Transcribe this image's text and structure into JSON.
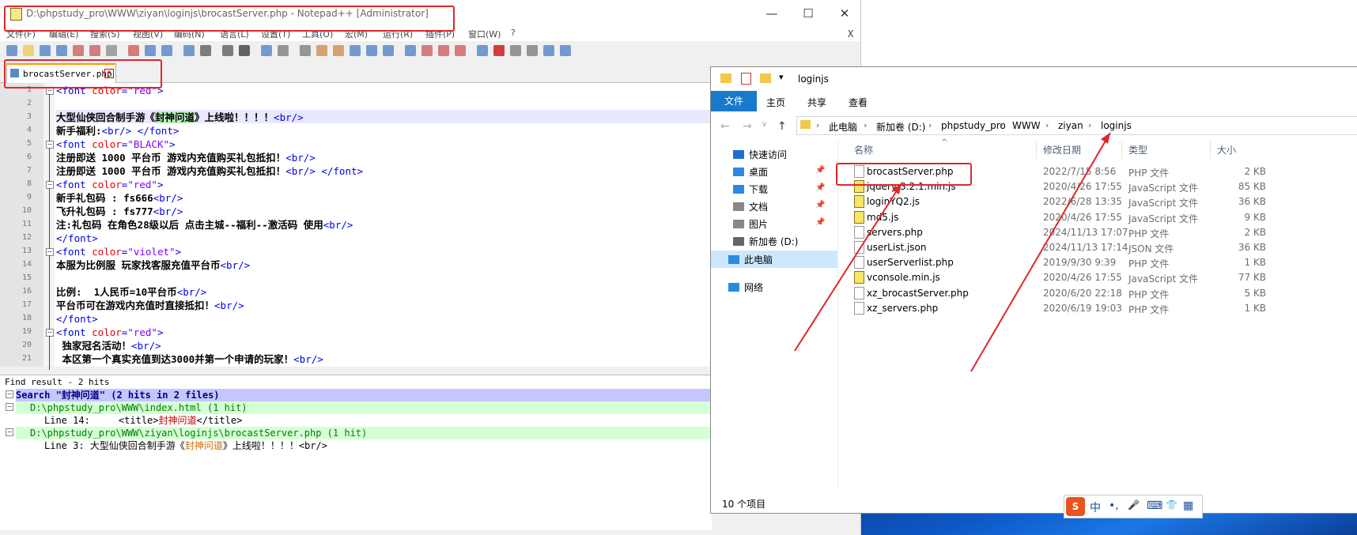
{
  "notepad": {
    "title": "D:\\phpstudy_pro\\WWW\\ziyan\\loginjs\\brocastServer.php - Notepad++ [Administrator]",
    "menu": [
      "文件(F)",
      "编辑(E)",
      "搜索(S)",
      "视图(V)",
      "编码(N)",
      "语言(L)",
      "设置(T)",
      "工具(O)",
      "宏(M)",
      "运行(R)",
      "插件(P)",
      "窗口(W)",
      "?"
    ],
    "close_x": "X",
    "tab_label": "brocastServer.php",
    "lines": [
      {
        "n": "1",
        "parts": [
          {
            "c": "tag",
            "t": "<font "
          },
          {
            "c": "attr",
            "t": "color"
          },
          {
            "c": "tag",
            "t": "="
          },
          {
            "c": "val",
            "t": "\"red\""
          },
          {
            "c": "tag",
            "t": ">"
          }
        ]
      },
      {
        "n": "2",
        "parts": []
      },
      {
        "n": "3",
        "parts": [
          {
            "c": "b",
            "t": "大型仙侠回合制手游《"
          },
          {
            "c": "b mark",
            "t": "封神问道"
          },
          {
            "c": "b",
            "t": "》上线啦！！！！"
          },
          {
            "c": "tag",
            "t": "<br/>"
          }
        ]
      },
      {
        "n": "4",
        "parts": [
          {
            "c": "b",
            "t": "新手福利:"
          },
          {
            "c": "tag",
            "t": "<br/> </font>"
          }
        ]
      },
      {
        "n": "5",
        "parts": [
          {
            "c": "tag",
            "t": "<font "
          },
          {
            "c": "attr",
            "t": "color"
          },
          {
            "c": "tag",
            "t": "="
          },
          {
            "c": "val",
            "t": "\"BLACK\""
          },
          {
            "c": "tag",
            "t": ">"
          }
        ]
      },
      {
        "n": "6",
        "parts": [
          {
            "c": "b",
            "t": "注册即送 1000 平台币 游戏内充值购买礼包抵扣！"
          },
          {
            "c": "tag",
            "t": "<br/>"
          }
        ]
      },
      {
        "n": "7",
        "parts": [
          {
            "c": "b",
            "t": "注册即送 1000 平台币 游戏内充值购买礼包抵扣！"
          },
          {
            "c": "tag",
            "t": "<br/> </font>"
          }
        ]
      },
      {
        "n": "8",
        "parts": [
          {
            "c": "tag",
            "t": "<font "
          },
          {
            "c": "attr",
            "t": "color"
          },
          {
            "c": "tag",
            "t": "="
          },
          {
            "c": "val",
            "t": "\"red\""
          },
          {
            "c": "tag",
            "t": ">"
          }
        ]
      },
      {
        "n": "9",
        "parts": [
          {
            "c": "b",
            "t": "新手礼包码 : fs666"
          },
          {
            "c": "tag",
            "t": "<br/>"
          }
        ]
      },
      {
        "n": "10",
        "parts": [
          {
            "c": "b",
            "t": "飞升礼包码 : fs777"
          },
          {
            "c": "tag",
            "t": "<br/>"
          }
        ]
      },
      {
        "n": "11",
        "parts": [
          {
            "c": "b",
            "t": "注:礼包码 在角色28级以后 点击主城--福利--激活码 使用"
          },
          {
            "c": "tag",
            "t": "<br/>"
          }
        ]
      },
      {
        "n": "12",
        "parts": [
          {
            "c": "tag",
            "t": "</font>"
          }
        ]
      },
      {
        "n": "13",
        "parts": [
          {
            "c": "tag",
            "t": "<font "
          },
          {
            "c": "attr",
            "t": "color"
          },
          {
            "c": "tag",
            "t": "="
          },
          {
            "c": "val",
            "t": "\"violet\""
          },
          {
            "c": "tag",
            "t": ">"
          }
        ]
      },
      {
        "n": "14",
        "parts": [
          {
            "c": "b",
            "t": "本服为比例服 玩家找客服充值平台币"
          },
          {
            "c": "tag",
            "t": "<br/>"
          }
        ]
      },
      {
        "n": "15",
        "parts": []
      },
      {
        "n": "16",
        "parts": [
          {
            "c": "b",
            "t": "比例:  1人民币=10平台币"
          },
          {
            "c": "tag",
            "t": "<br/>"
          }
        ]
      },
      {
        "n": "17",
        "parts": [
          {
            "c": "b",
            "t": "平台币可在游戏内充值时直接抵扣！"
          },
          {
            "c": "tag",
            "t": "<br/>"
          }
        ]
      },
      {
        "n": "18",
        "parts": [
          {
            "c": "tag",
            "t": "</font>"
          }
        ]
      },
      {
        "n": "19",
        "parts": [
          {
            "c": "tag",
            "t": "<font "
          },
          {
            "c": "attr",
            "t": "color"
          },
          {
            "c": "tag",
            "t": "="
          },
          {
            "c": "val",
            "t": "\"red\""
          },
          {
            "c": "tag",
            "t": ">"
          }
        ]
      },
      {
        "n": "20",
        "parts": [
          {
            "c": "b",
            "t": " 独家冠名活动！"
          },
          {
            "c": "tag",
            "t": "<br/>"
          }
        ]
      },
      {
        "n": "21",
        "parts": [
          {
            "c": "b",
            "t": " 本区第一个真实充值到达3000并第一个申请的玩家！"
          },
          {
            "c": "tag",
            "t": "<br/>"
          }
        ]
      }
    ],
    "find_header": "Find result - 2 hits",
    "find": {
      "search_prefix": "Search \"",
      "search_term": "封神问道",
      "search_suffix": "\" (2 hits in 2 files)",
      "file1": "D:\\phpstudy_pro\\WWW\\index.html (1 hit)",
      "hit1_prefix": "Line 14:     <title>",
      "hit1_term": "封神问道",
      "hit1_suffix": "</title>",
      "file2": "D:\\phpstudy_pro\\WWW\\ziyan\\loginjs\\brocastServer.php (1 hit)",
      "hit2_prefix": "Line 3: 大型仙侠回合制手游《",
      "hit2_term": "封神问道",
      "hit2_suffix": "》上线啦！！！！<br/>"
    }
  },
  "explorer": {
    "title": "loginjs",
    "ribbon": {
      "file": "文件",
      "tabs": [
        "主页",
        "共享",
        "查看"
      ]
    },
    "breadcrumb": [
      "此电脑",
      "新加卷 (D:)",
      "phpstudy_pro",
      "WWW",
      "ziyan",
      "loginjs"
    ],
    "nav": [
      "快速访问",
      "桌面",
      "下载",
      "文档",
      "图片",
      "新加卷 (D:)",
      "此电脑",
      "网络"
    ],
    "columns": {
      "name": "名称",
      "date": "修改日期",
      "type": "类型",
      "size": "大小"
    },
    "files": [
      {
        "name": "brocastServer.php",
        "date": "2022/7/15 8:56",
        "type": "PHP 文件",
        "size": "2 KB",
        "js": false
      },
      {
        "name": "jquery-3.2.1.min.js",
        "date": "2020/4/26 17:55",
        "type": "JavaScript 文件",
        "size": "85 KB",
        "js": true
      },
      {
        "name": "loginYQ2.js",
        "date": "2022/6/28 13:35",
        "type": "JavaScript 文件",
        "size": "36 KB",
        "js": true
      },
      {
        "name": "md5.js",
        "date": "2020/4/26 17:55",
        "type": "JavaScript 文件",
        "size": "9 KB",
        "js": true
      },
      {
        "name": "servers.php",
        "date": "2024/11/13 17:07",
        "type": "PHP 文件",
        "size": "2 KB",
        "js": false
      },
      {
        "name": "userList.json",
        "date": "2024/11/13 17:14",
        "type": "JSON 文件",
        "size": "36 KB",
        "js": false
      },
      {
        "name": "userServerlist.php",
        "date": "2019/9/30 9:39",
        "type": "PHP 文件",
        "size": "1 KB",
        "js": false
      },
      {
        "name": "vconsole.min.js",
        "date": "2020/4/26 17:55",
        "type": "JavaScript 文件",
        "size": "77 KB",
        "js": true
      },
      {
        "name": "xz_brocastServer.php",
        "date": "2020/6/20 22:18",
        "type": "PHP 文件",
        "size": "5 KB",
        "js": false
      },
      {
        "name": "xz_servers.php",
        "date": "2020/6/19 19:03",
        "type": "PHP 文件",
        "size": "1 KB",
        "js": false
      }
    ],
    "status": "10 个项目"
  },
  "ime": {
    "brand": "S",
    "items": [
      "中",
      "•,",
      "🎤",
      "⌨",
      "👕",
      "▦"
    ]
  }
}
